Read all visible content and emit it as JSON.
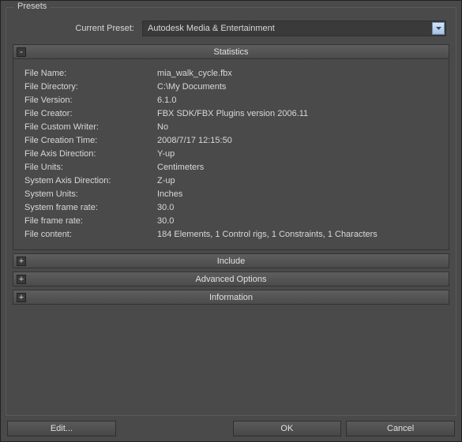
{
  "presets": {
    "legend": "Presets",
    "current_preset_label": "Current Preset:",
    "current_preset_value": "Autodesk Media & Entertainment"
  },
  "sections": {
    "statistics": {
      "toggle": "-",
      "title": "Statistics",
      "rows": [
        {
          "label": "File Name:",
          "value": "mia_walk_cycle.fbx"
        },
        {
          "label": "File Directory:",
          "value": "C:\\My Documents"
        },
        {
          "label": "File Version:",
          "value": "6.1.0"
        },
        {
          "label": "File Creator:",
          "value": "FBX SDK/FBX Plugins version 2006.11"
        },
        {
          "label": "File Custom Writer:",
          "value": "No"
        },
        {
          "label": "File Creation Time:",
          "value": "2008/7/17  12:15:50"
        },
        {
          "label": "File Axis Direction:",
          "value": "Y-up"
        },
        {
          "label": "File Units:",
          "value": "Centimeters"
        },
        {
          "label": "System Axis Direction:",
          "value": "Z-up"
        },
        {
          "label": "System Units:",
          "value": "Inches"
        },
        {
          "label": "System frame rate:",
          "value": "30.0"
        },
        {
          "label": "File frame rate:",
          "value": "30.0"
        },
        {
          "label": "File content:",
          "value": "184 Elements,   1 Control rigs,   1 Constraints,   1 Characters"
        }
      ]
    },
    "include": {
      "toggle": "+",
      "title": "Include"
    },
    "advanced": {
      "toggle": "+",
      "title": "Advanced Options"
    },
    "information": {
      "toggle": "+",
      "title": "Information"
    }
  },
  "buttons": {
    "edit": "Edit...",
    "ok": "OK",
    "cancel": "Cancel"
  }
}
